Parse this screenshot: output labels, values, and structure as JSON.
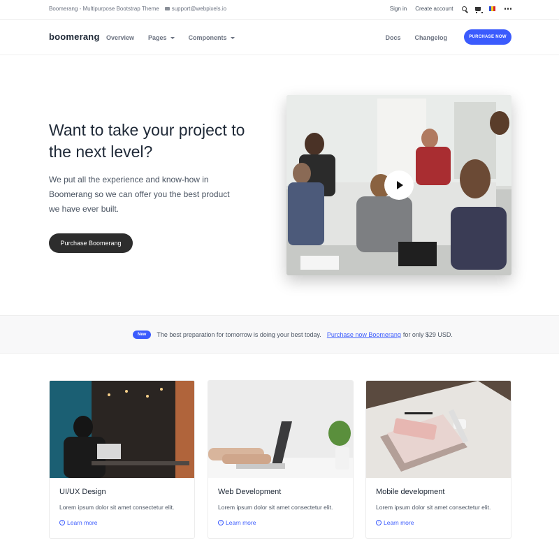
{
  "topbar": {
    "tagline": "Boomerang - Multipurpose Bootstrap Theme",
    "email": "support@webpixels.io",
    "sign_in": "Sign in",
    "create_account": "Create account",
    "icons": [
      "mail-icon",
      "search-icon",
      "cart-icon",
      "flag-icon",
      "more-icon"
    ]
  },
  "navbar": {
    "brand": "boomerang",
    "links": [
      {
        "label": "Overview"
      },
      {
        "label": "Pages"
      },
      {
        "label": "Components"
      }
    ],
    "docs": "Docs",
    "changelog": "Changelog",
    "purchase_label": "PURCHASE NOW",
    "accent": "#3b5bfd"
  },
  "hero": {
    "title": "Want to take your project to the next level?",
    "text": "We put all the experience and know-how in Boomerang so we can offer you the best product we have ever built.",
    "button": "Purchase Boomerang",
    "media_icon": "play-icon"
  },
  "announcement": {
    "badge": "New",
    "text": "The best preparation for tomorrow is doing your best today.",
    "link": "Purchase now Boomerang",
    "suffix": "for only $29 USD."
  },
  "cards": [
    {
      "title": "UI/UX Design",
      "text": "Lorem ipsum dolor sit amet consectetur elit.",
      "link": "Learn more"
    },
    {
      "title": "Web Development",
      "text": "Lorem ipsum dolor sit amet consectetur elit.",
      "link": "Learn more"
    },
    {
      "title": "Mobile development",
      "text": "Lorem ipsum dolor sit amet consectetur elit.",
      "link": "Learn more"
    }
  ]
}
